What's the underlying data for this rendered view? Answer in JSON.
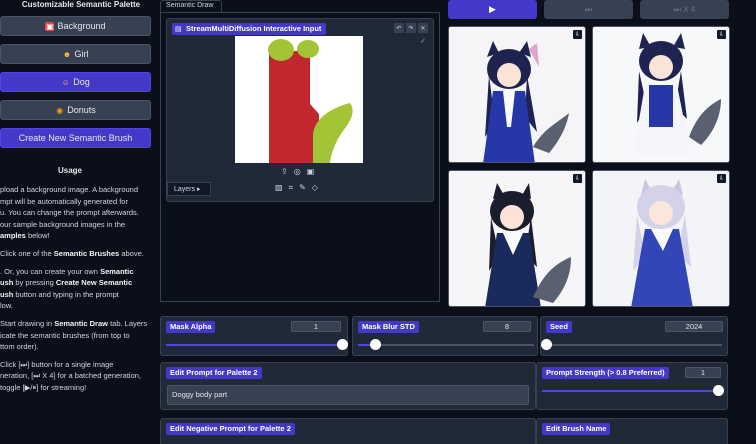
{
  "palette": {
    "title": "Customizable Semantic Palette",
    "items": [
      {
        "label": "Background",
        "icon": "background-swatch-icon",
        "color": "#ef4444"
      },
      {
        "label": "Girl",
        "icon": "girl-emoji-icon",
        "color": "#f59e0b"
      },
      {
        "label": "Dog",
        "icon": "dog-emoji-icon",
        "color": "#f97316"
      },
      {
        "label": "Donuts",
        "icon": "donut-emoji-icon",
        "color": "#f59e0b"
      }
    ],
    "create_label": "Create New Semantic Brush"
  },
  "usage": {
    "title": "Usage",
    "p1a": "pload a background image. A background",
    "p1b": "mpt will be automatically generated for",
    "p1c": "u. You can change the prompt afterwards.",
    "p1d": " our sample background images in the",
    "p1e_bold": "amples",
    "p1e": " below!",
    "p2a": "Click one of the ",
    "p2b_bold": "Semantic Brushes",
    "p2c": " above.",
    "p3a": ". Or, you can create your own ",
    "p3b_bold": "Semantic",
    "p3c_bold": "ush",
    "p3d": " by pressing ",
    "p3e_bold": "Create New Semantic",
    "p3f_bold": "ush",
    "p3g": " button and typing in the prompt",
    "p3h": "low.",
    "p4a": "Start drawing in ",
    "p4b_bold": "Semantic Draw",
    "p4c": " tab. Layers",
    "p4d": "icate the semantic brushes (from top to",
    "p4e": "ttom order).",
    "p5a": "Click [⏭] button for a single image",
    "p5b": "neration, [⏭ X 4] for a batched generation,",
    "p5c": "toggle [▶/⏸] for streaming!"
  },
  "tabs": {
    "semantic_draw": "Semantic Draw"
  },
  "input": {
    "label": "StreamMultiDiffusion Interactive Input",
    "layers_label": "Layers ▸"
  },
  "controls": {
    "play": "▶",
    "next": "⏭",
    "next4": "⏭ X 4"
  },
  "sliders": {
    "mask_alpha": {
      "label": "Mask Alpha",
      "value": "1",
      "fraction": 1.0
    },
    "mask_blur": {
      "label": "Mask Blur STD",
      "value": "8",
      "fraction": 0.1
    },
    "seed": {
      "label": "Seed",
      "value": "2024",
      "fraction": 0.0
    }
  },
  "prompt": {
    "label": "Edit Prompt for Palette 2",
    "value": "Doggy body part"
  },
  "strength": {
    "label": "Prompt Strength (> 0.8 Preferred)",
    "value": "1",
    "fraction": 1.0
  },
  "negative": {
    "label": "Edit Negative Prompt for Palette 2"
  },
  "brush_name": {
    "label": "Edit Brush Name"
  },
  "colors": {
    "accent": "#4338ca",
    "bg": "#0b0f19",
    "panel": "#1f2937"
  }
}
